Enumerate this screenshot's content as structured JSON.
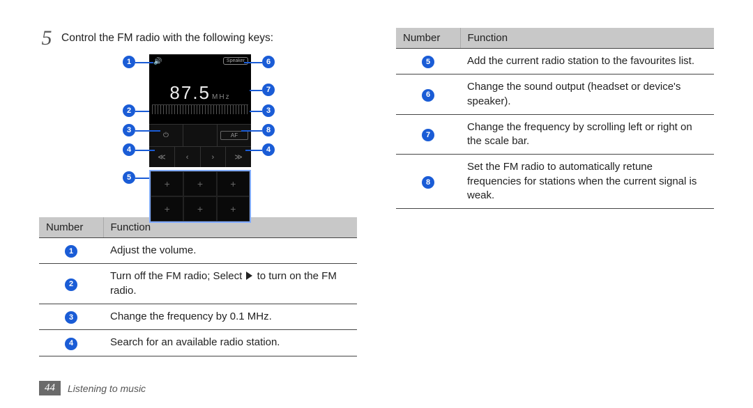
{
  "step": {
    "number": "5",
    "text": "Control the FM radio with the following keys:"
  },
  "diagram": {
    "speaker_label": "Speaker",
    "frequency_value": "87.5",
    "frequency_unit": "MHz",
    "af_label": "AF",
    "callouts": [
      "1",
      "2",
      "3",
      "4",
      "5",
      "6",
      "7",
      "8"
    ]
  },
  "table_header": {
    "col1": "Number",
    "col2": "Function"
  },
  "left_rows": [
    {
      "n": "1",
      "text": "Adjust the volume."
    },
    {
      "n": "2",
      "text_before": "Turn off the FM radio; Select ",
      "text_after": " to turn on the FM radio.",
      "has_play": true
    },
    {
      "n": "3",
      "text": "Change the frequency by 0.1 MHz."
    },
    {
      "n": "4",
      "text": "Search for an available radio station."
    }
  ],
  "right_rows": [
    {
      "n": "5",
      "text": "Add the current radio station to the favourites list."
    },
    {
      "n": "6",
      "text": "Change the sound output (headset or device's speaker)."
    },
    {
      "n": "7",
      "text": "Change the frequency by scrolling left or right on the scale bar."
    },
    {
      "n": "8",
      "text": "Set the FM radio to automatically retune frequencies for stations when the current signal is weak."
    }
  ],
  "footer": {
    "page": "44",
    "title": "Listening to music"
  }
}
